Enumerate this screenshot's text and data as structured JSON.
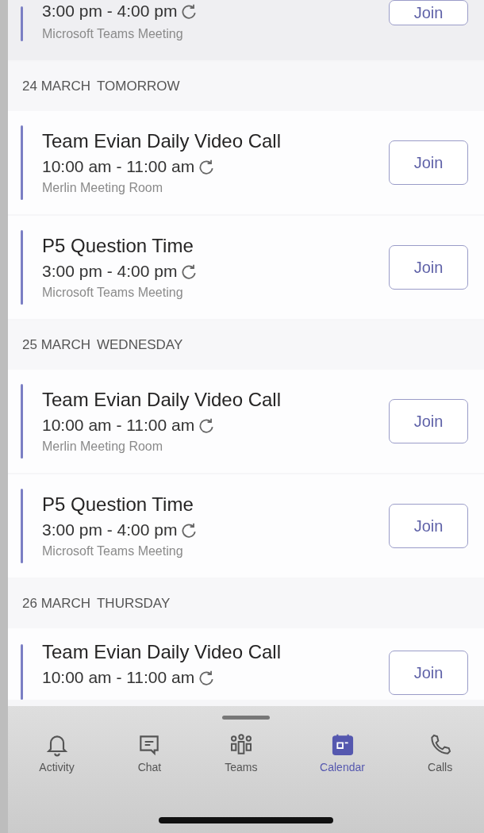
{
  "leading_event": {
    "time": "3:00 pm - 4:00 pm",
    "recurring": true,
    "location": "Microsoft Teams Meeting",
    "button": "Join"
  },
  "days": [
    {
      "date": "24 MARCH",
      "label": "TOMORROW",
      "events": [
        {
          "title": "Team Evian Daily Video Call",
          "time": "10:00 am - 11:00 am",
          "recurring": true,
          "location": "Merlin Meeting Room",
          "button": "Join"
        },
        {
          "title": "P5 Question Time",
          "time": "3:00 pm - 4:00 pm",
          "recurring": true,
          "location": "Microsoft Teams Meeting",
          "button": "Join"
        }
      ]
    },
    {
      "date": "25 MARCH",
      "label": "WEDNESDAY",
      "events": [
        {
          "title": "Team Evian Daily Video Call",
          "time": "10:00 am - 11:00 am",
          "recurring": true,
          "location": "Merlin Meeting Room",
          "button": "Join"
        },
        {
          "title": "P5 Question Time",
          "time": "3:00 pm - 4:00 pm",
          "recurring": true,
          "location": "Microsoft Teams Meeting",
          "button": "Join"
        }
      ]
    },
    {
      "date": "26 MARCH",
      "label": "THURSDAY",
      "events": [
        {
          "title": "Team Evian Daily Video Call",
          "time": "10:00 am - 11:00 am",
          "recurring": true,
          "button": "Join"
        }
      ]
    }
  ],
  "tabs": [
    {
      "kind": "activity",
      "label": "Activity",
      "selected": false
    },
    {
      "kind": "chat",
      "label": "Chat",
      "selected": false
    },
    {
      "kind": "teams",
      "label": "Teams",
      "selected": false
    },
    {
      "kind": "calendar",
      "label": "Calendar",
      "selected": true
    },
    {
      "kind": "calls",
      "label": "Calls",
      "selected": false
    }
  ]
}
